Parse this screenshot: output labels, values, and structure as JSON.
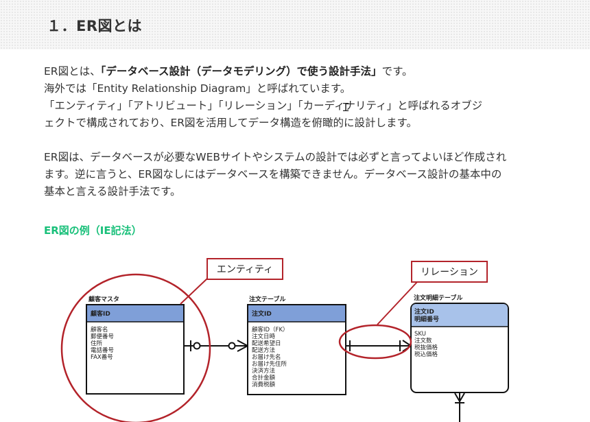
{
  "heading": "１．ER図とは",
  "paragraph1": {
    "line1_before": "ER図とは、",
    "line1_bold": "「データベース設計（データモデリング）で使う設計手法」",
    "line1_after": "です。",
    "line2": "海外では「Entity Relationship Diagram」と呼ばれています。",
    "line3": "「エンティティ」「アトリビュート」「リレーション」「カーディナリティ」と呼ばれるオブジ",
    "line4": "ェクトで構成されており、ER図を活用してデータ構造を俯瞰的に設計します。"
  },
  "paragraph2": {
    "line1": "ER図は、データベースが必要なWEBサイトやシステムの設計では必ずと言ってよいほど作成され",
    "line2": "ます。逆に言うと、ER図なしにはデータベースを構築できません。データベース設計の基本中の",
    "line3": "基本と言える設計手法です。"
  },
  "sub_heading": "ER図の例（IE記法）",
  "diagram": {
    "callout_entity": "エンティティ",
    "callout_relation": "リレーション",
    "entities": [
      {
        "title": "顧客マスタ",
        "keys": [
          "顧客ID"
        ],
        "attributes": [
          "顧客名",
          "郵便番号",
          "住所",
          "電話番号",
          "FAX番号"
        ]
      },
      {
        "title": "注文テーブル",
        "keys": [
          "注文ID"
        ],
        "attributes": [
          "顧客ID（FK）",
          "注文日時",
          "配送希望日",
          "配送方法",
          "お届け先名",
          "お届け先住所",
          "決済方法",
          "合計金額",
          "消費税額"
        ]
      },
      {
        "title": "注文明細テーブル",
        "keys": [
          "注文ID",
          "明細番号"
        ],
        "attributes": [
          "SKU",
          "注文数",
          "税抜価格",
          "税込価格"
        ]
      }
    ],
    "colors": {
      "circle": "#b3232a",
      "key_fill_1": "#7f9fd8",
      "key_fill_3": "#a8c2ea",
      "line": "#111111"
    }
  },
  "colors": {
    "sub_heading": "#19c07a",
    "text": "#333333",
    "heading_band": "#f7f7f7"
  }
}
